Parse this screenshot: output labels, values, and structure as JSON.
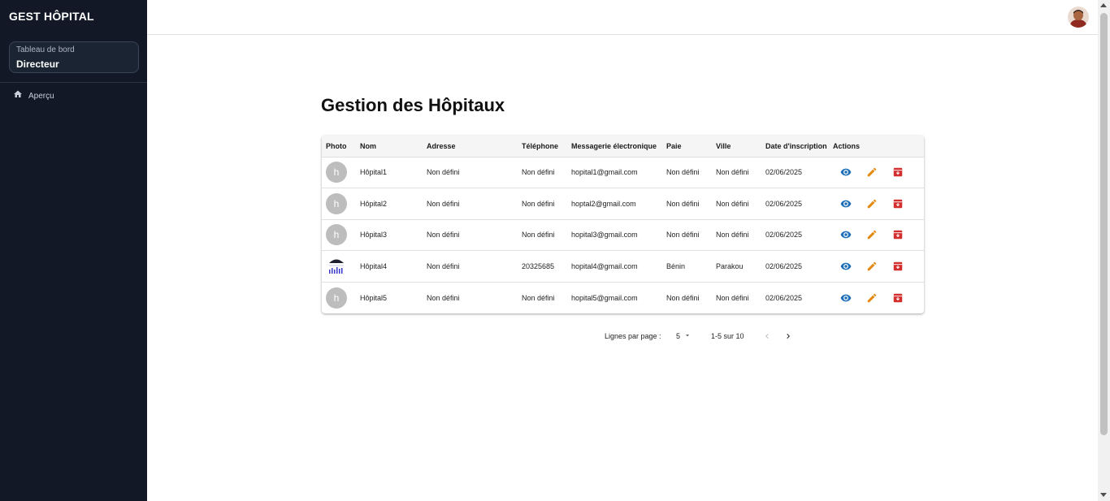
{
  "sidebar": {
    "brand": "GEST HÔPITAL",
    "dashboard": {
      "subtitle": "Tableau de bord",
      "role": "Directeur"
    },
    "items": [
      {
        "label": "Aperçu",
        "icon": "home-icon"
      }
    ]
  },
  "page": {
    "title": "Gestion des Hôpitaux"
  },
  "table": {
    "headers": [
      "Photo",
      "Nom",
      "Adresse",
      "Téléphone",
      "Messagerie électronique",
      "Paie",
      "Ville",
      "Date d'inscription",
      "Actions"
    ],
    "rows": [
      {
        "photo": "h",
        "nom": "Hôpital1",
        "adresse": "Non défini",
        "telephone": "Non défini",
        "email": "hopital1@gmail.com",
        "paie": "Non défini",
        "ville": "Non défini",
        "date": "02/06/2025"
      },
      {
        "photo": "h",
        "nom": "Hôpital2",
        "adresse": "Non défini",
        "telephone": "Non défini",
        "email": "hoptal2@gmail.com",
        "paie": "Non défini",
        "ville": "Non défini",
        "date": "02/06/2025"
      },
      {
        "photo": "h",
        "nom": "Hôpital3",
        "adresse": "Non défini",
        "telephone": "Non défini",
        "email": "hopital3@gmail.com",
        "paie": "Non défini",
        "ville": "Non défini",
        "date": "02/06/2025"
      },
      {
        "photo": "",
        "nom": "Hôpital4",
        "adresse": "Non défini",
        "telephone": "20325685",
        "email": "hopital4@gmail.com",
        "paie": "Bénin",
        "ville": "Parakou",
        "date": "02/06/2025"
      },
      {
        "photo": "h",
        "nom": "Hôpital5",
        "adresse": "Non défini",
        "telephone": "Non défini",
        "email": "hopital5@gmail.com",
        "paie": "Non défini",
        "ville": "Non défini",
        "date": "02/06/2025"
      }
    ],
    "action_icons": [
      "eye-icon",
      "pencil-icon",
      "delete-box-icon"
    ]
  },
  "pagination": {
    "rows_per_page_label": "Lignes par page :",
    "rows_per_page": "5",
    "range": "1-5 sur 10"
  },
  "colors": {
    "sidebar_bg": "#121826",
    "view": "#1e6fb8",
    "edit": "#e38a12",
    "delete": "#d32f2f"
  }
}
